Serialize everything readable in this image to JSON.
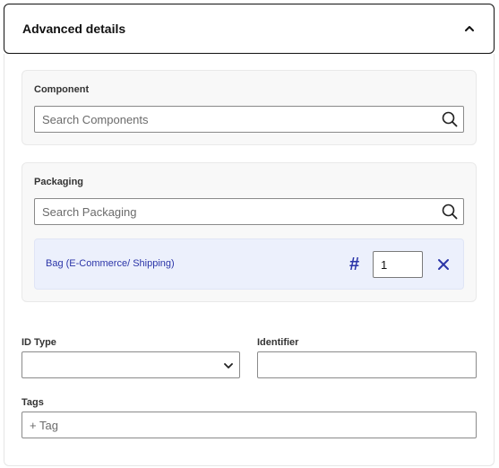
{
  "header": {
    "title": "Advanced details",
    "icon": "chevron-up-icon"
  },
  "component": {
    "label": "Component",
    "search_placeholder": "Search Components",
    "icon": "search-icon"
  },
  "packaging": {
    "label": "Packaging",
    "search_placeholder": "Search Packaging",
    "icon": "search-icon",
    "items": [
      {
        "name": "Bag (E-Commerce/ Shipping)",
        "quantity": "1"
      }
    ]
  },
  "id_type": {
    "label": "ID Type",
    "value": ""
  },
  "identifier": {
    "label": "Identifier",
    "value": ""
  },
  "tags": {
    "label": "Tags",
    "placeholder": "+ Tag"
  },
  "colors": {
    "accent": "#2b35a8",
    "item_bg": "#ecf0fc",
    "card_bg": "#f8f8f8"
  }
}
